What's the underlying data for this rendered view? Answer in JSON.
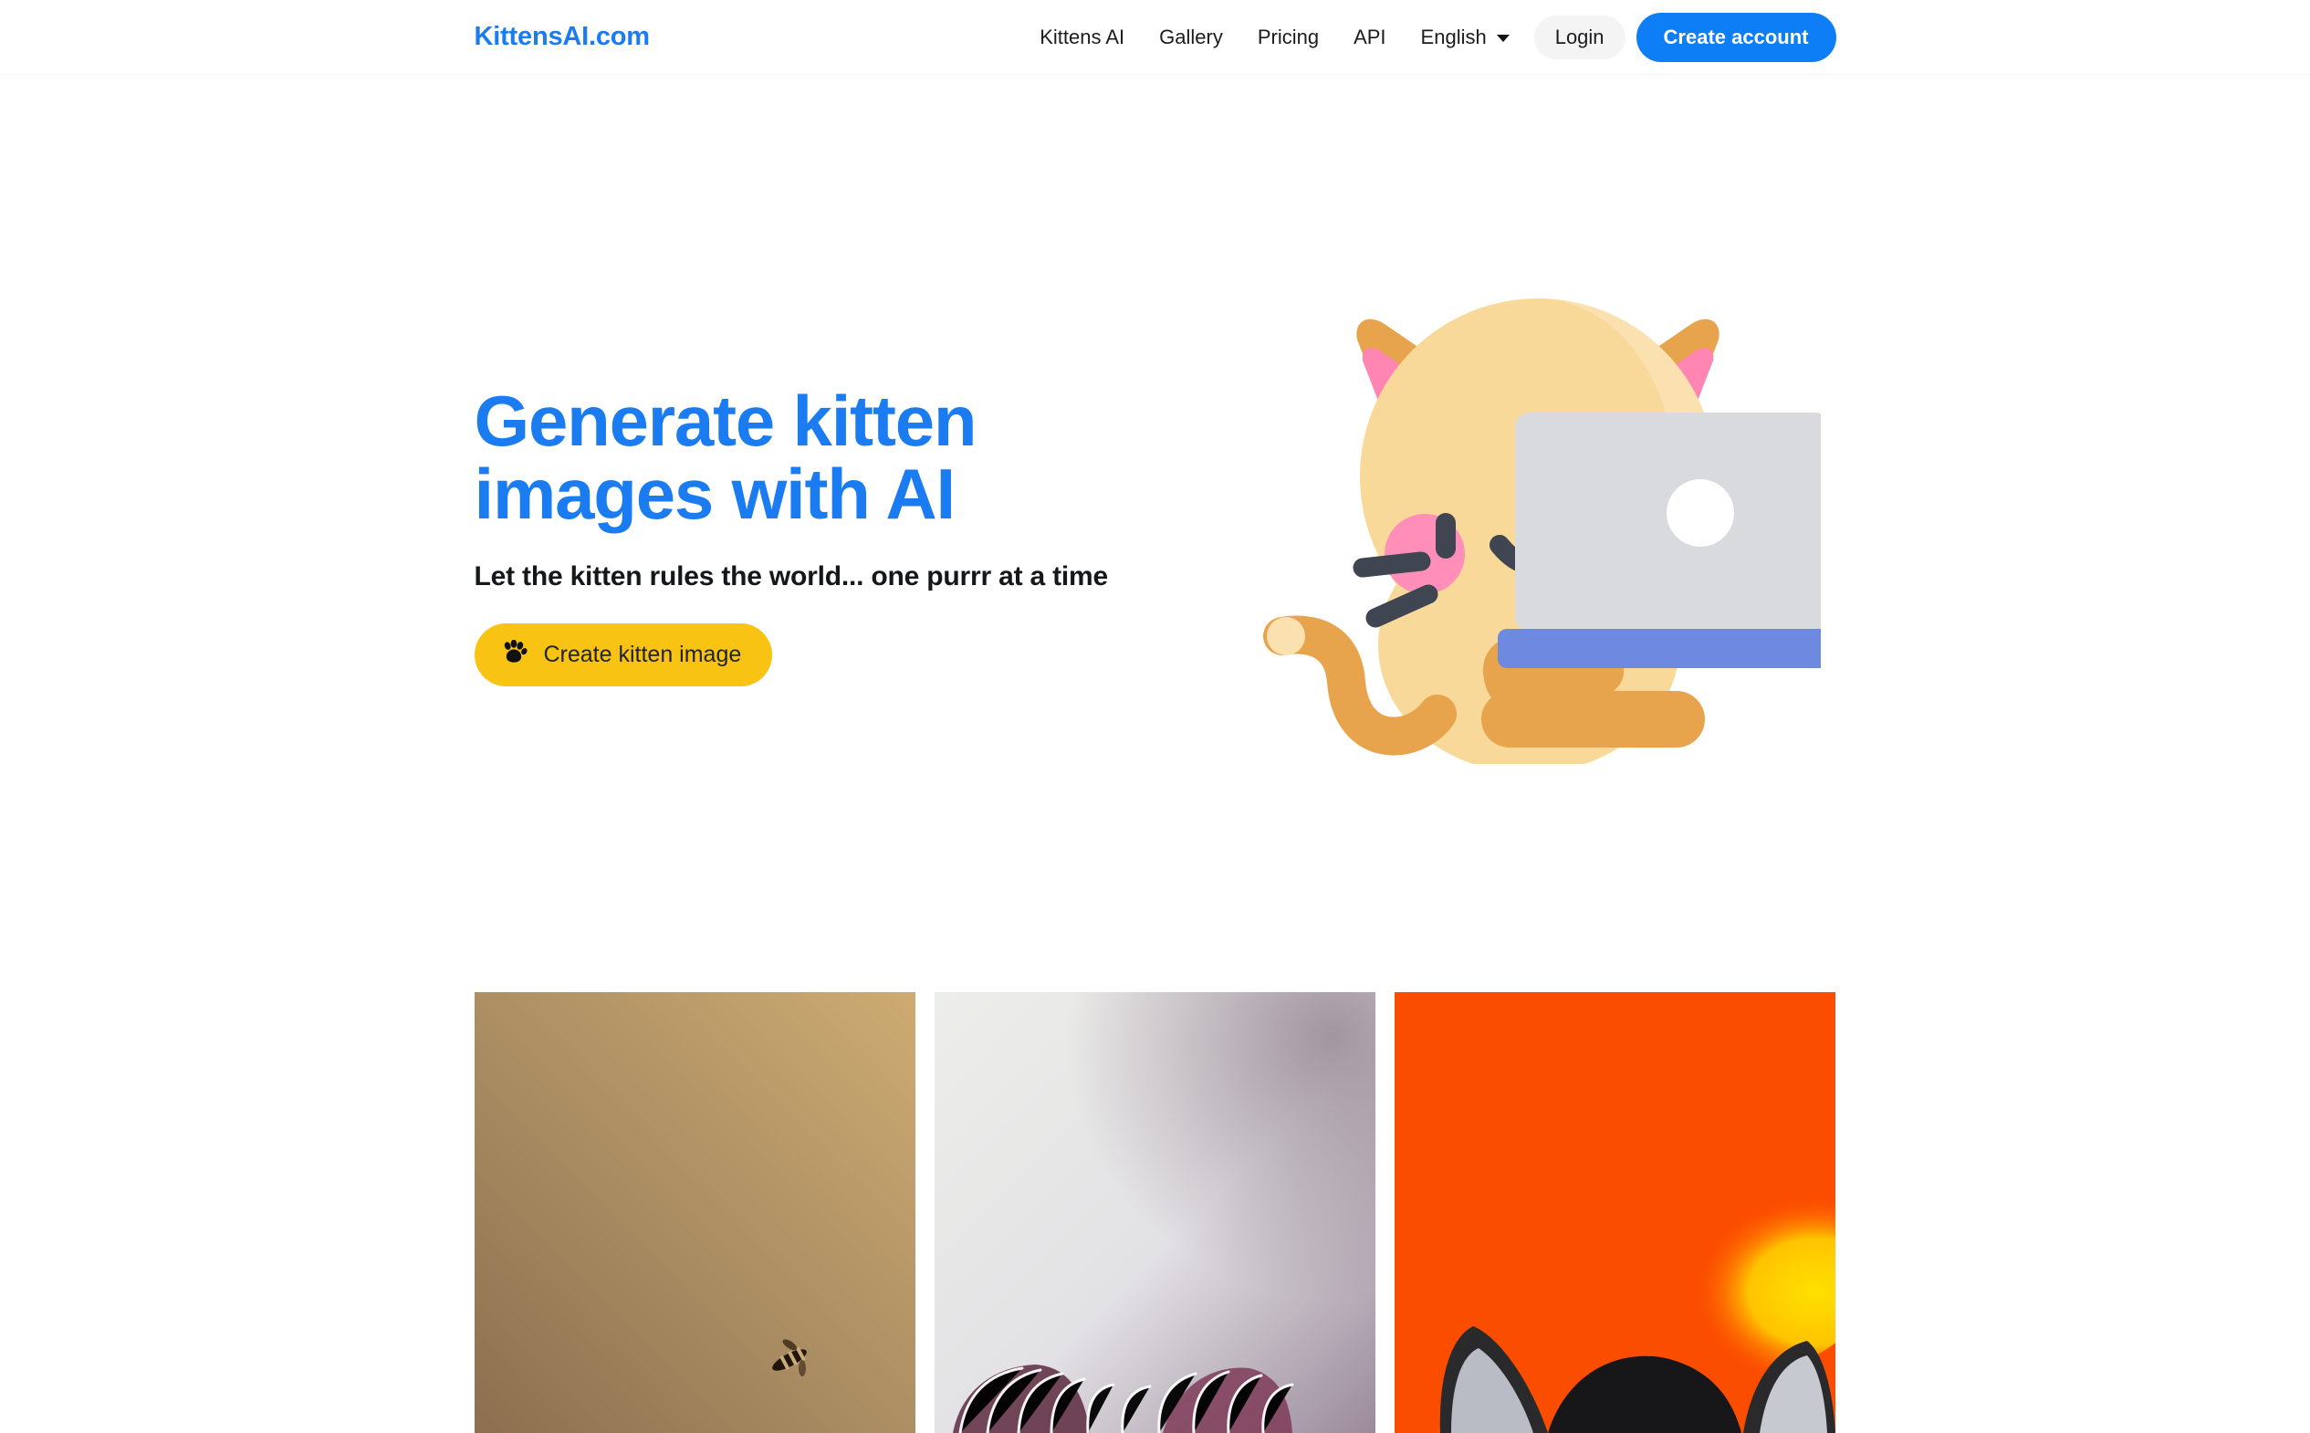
{
  "header": {
    "brand": "KittensAI.com",
    "nav_links": [
      {
        "label": "Kittens AI",
        "name": "nav-kittens-ai"
      },
      {
        "label": "Gallery",
        "name": "nav-gallery"
      },
      {
        "label": "Pricing",
        "name": "nav-pricing"
      },
      {
        "label": "API",
        "name": "nav-api"
      }
    ],
    "language": {
      "label": "English",
      "icon": "chevron-down-icon"
    },
    "login_label": "Login",
    "create_account_label": "Create account"
  },
  "hero": {
    "title_line1": "Generate kitten",
    "title_line2": "images with AI",
    "subtitle": "Let the kitten rules the world... one purrr at a time",
    "cta_label": "Create kitten image",
    "cta_icon": "paw-print-icon",
    "illustration": "kitten-with-laptop-illustration"
  },
  "gallery": {
    "items": [
      {
        "name": "gallery-image-bee-on-tan",
        "alt": "Tan golden background with dark striped insect"
      },
      {
        "name": "gallery-image-white-kitten-ears",
        "alt": "Pale lavender white background with white fur and pink ears"
      },
      {
        "name": "gallery-image-orange-sunset-cat",
        "alt": "Vivid orange background with yellow glow and grey cat ears"
      }
    ]
  },
  "colors": {
    "brand_blue": "#1a7cf0",
    "button_blue": "#0d7ef5",
    "cta_yellow": "#f8c313",
    "login_grey": "#f4f4f5",
    "text_dark": "#16171a",
    "cat_body": "#f8d99a",
    "cat_body_shade": "#fbe1af",
    "cat_orange": "#e8a44d",
    "cat_pink": "#ff85b3",
    "cat_blush": "#ff8fb8",
    "cat_face_dark": "#3f4551",
    "laptop_grey": "#d9dade",
    "laptop_blue": "#6d8ae0"
  }
}
